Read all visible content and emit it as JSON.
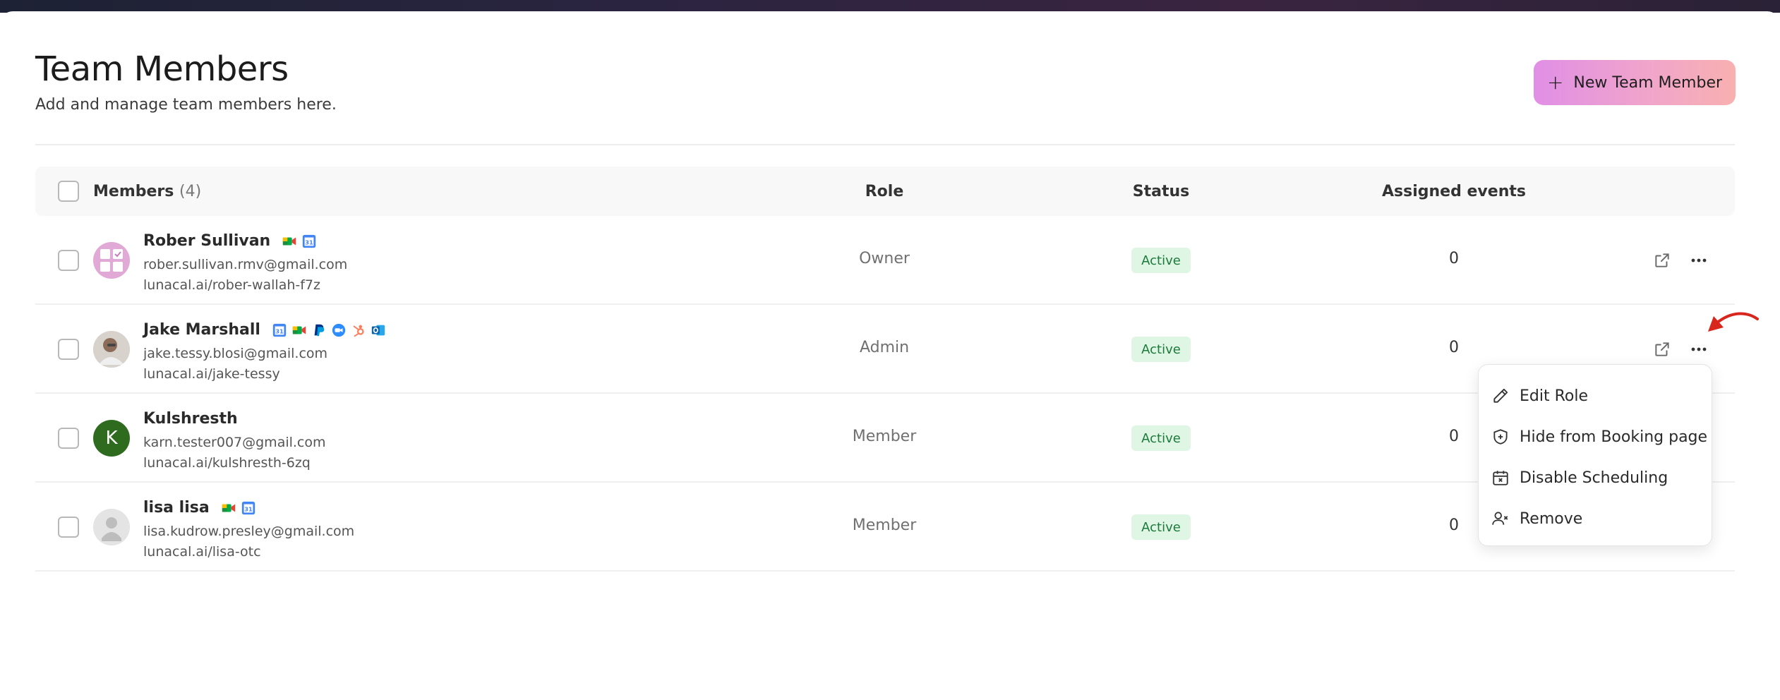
{
  "page": {
    "title": "Team Members",
    "subtitle": "Add and manage team members here.",
    "new_button_label": "New Team Member"
  },
  "table": {
    "headers": {
      "members": "Members",
      "members_count": "(4)",
      "role": "Role",
      "status": "Status",
      "assigned_events": "Assigned events"
    },
    "rows": [
      {
        "name": "Rober Sullivan",
        "email": "rober.sullivan.rmv@gmail.com",
        "link": "lunacal.ai/rober-wallah-f7z",
        "role": "Owner",
        "status": "Active",
        "events": "0",
        "integrations": [
          "google-meet-icon",
          "google-calendar-icon"
        ]
      },
      {
        "name": "Jake Marshall",
        "email": "jake.tessy.blosi@gmail.com",
        "link": "lunacal.ai/jake-tessy",
        "role": "Admin",
        "status": "Active",
        "events": "0",
        "integrations": [
          "google-calendar-icon",
          "google-meet-icon",
          "paypal-icon",
          "zoom-icon",
          "hubspot-icon",
          "outlook-icon"
        ]
      },
      {
        "name": "Kulshresth",
        "email": "karn.tester007@gmail.com",
        "link": "lunacal.ai/kulshresth-6zq",
        "role": "Member",
        "status": "Active",
        "events": "0",
        "avatar_letter": "K",
        "integrations": []
      },
      {
        "name": "lisa lisa",
        "email": "lisa.kudrow.presley@gmail.com",
        "link": "lunacal.ai/lisa-otc",
        "role": "Member",
        "status": "Active",
        "events": "0",
        "integrations": [
          "google-meet-icon",
          "google-calendar-icon"
        ]
      }
    ]
  },
  "context_menu": {
    "items": [
      {
        "label": "Edit Role",
        "icon": "pencil-icon"
      },
      {
        "label": "Hide from Booking page",
        "icon": "shield-plus-icon"
      },
      {
        "label": "Disable Scheduling",
        "icon": "calendar-x-icon"
      },
      {
        "label": "Remove",
        "icon": "user-x-icon"
      }
    ]
  },
  "colors": {
    "badge_bg": "#dff6e5",
    "badge_text": "#1c7a3a",
    "accent_gradient_start": "#e08fe6",
    "accent_gradient_end": "#f8b0b0",
    "annotation_arrow": "#d9261c"
  }
}
